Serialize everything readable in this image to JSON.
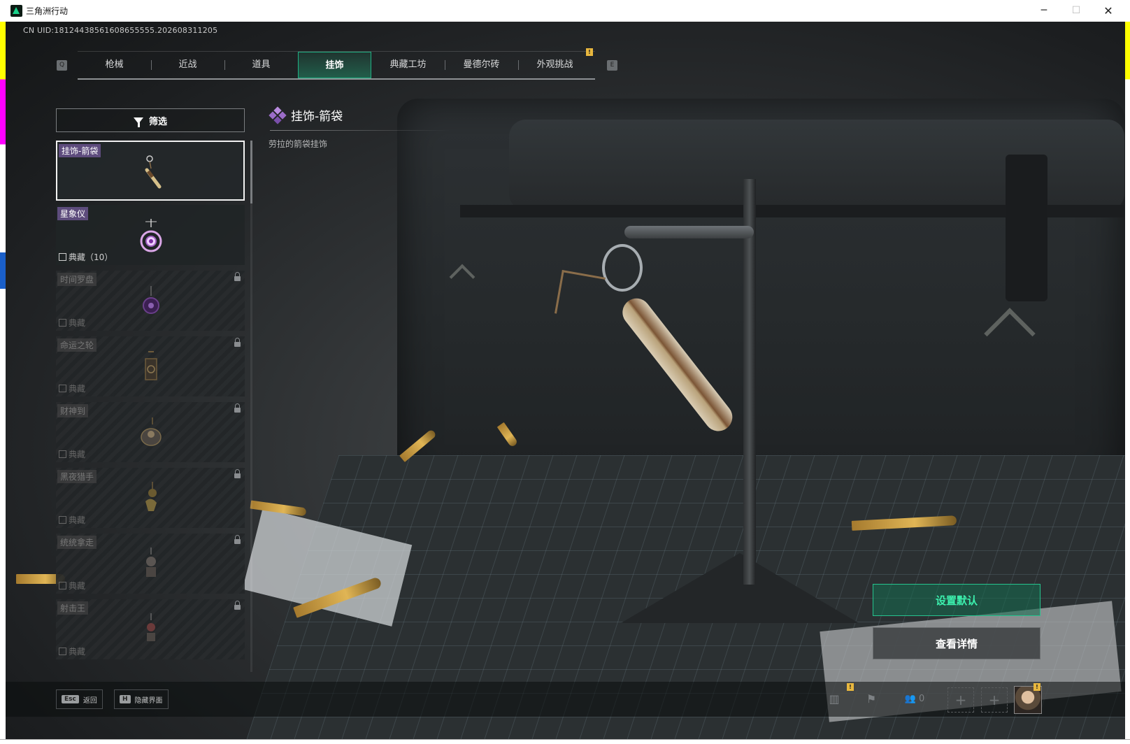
{
  "window": {
    "title": "三角洲行动",
    "controls": {
      "minimize": "─",
      "maximize": "☐",
      "close": "✕"
    }
  },
  "uid_text": "CN UID:18124438561608655555.202608311205",
  "tabs": {
    "prev_key": "Q",
    "next_key": "E",
    "items": [
      {
        "label": "枪械",
        "active": false
      },
      {
        "label": "近战",
        "active": false
      },
      {
        "label": "道具",
        "active": false
      },
      {
        "label": "挂饰",
        "active": true
      },
      {
        "label": "典藏工坊",
        "active": false
      },
      {
        "label": "曼德尔砖",
        "active": false
      },
      {
        "label": "外观挑战",
        "active": false
      }
    ],
    "badge": "!"
  },
  "filter": {
    "label": "筛选"
  },
  "items": [
    {
      "name": "挂饰-箭袋",
      "collection": "",
      "selected": true,
      "locked": false,
      "icon": "quiver-charm-icon"
    },
    {
      "name": "星象仪",
      "collection": "典藏（10）",
      "selected": false,
      "locked": false,
      "icon": "astrolabe-charm-icon"
    },
    {
      "name": "时间罗盘",
      "collection": "典藏",
      "selected": false,
      "locked": true,
      "icon": "time-compass-charm-icon"
    },
    {
      "name": "命运之轮",
      "collection": "典藏",
      "selected": false,
      "locked": true,
      "icon": "wheel-of-fate-charm-icon"
    },
    {
      "name": "财神到",
      "collection": "典藏",
      "selected": false,
      "locked": true,
      "icon": "god-of-wealth-charm-icon"
    },
    {
      "name": "黑夜猎手",
      "collection": "典藏",
      "selected": false,
      "locked": true,
      "icon": "night-hunter-charm-icon"
    },
    {
      "name": "统统拿走",
      "collection": "典藏",
      "selected": false,
      "locked": true,
      "icon": "take-all-charm-icon"
    },
    {
      "name": "射击王",
      "collection": "典藏",
      "selected": false,
      "locked": true,
      "icon": "shooting-king-charm-icon"
    }
  ],
  "detail": {
    "title": "挂饰-箭袋",
    "description": "劳拉的箭袋挂饰"
  },
  "actions": {
    "set_default": "设置默认",
    "view_details": "查看详情"
  },
  "bottom": {
    "back_key": "Esc",
    "back_label": "返回",
    "hide_key": "H",
    "hide_label": "隐藏界面",
    "friends_count": "0",
    "warn": "!"
  },
  "colors": {
    "accent": "#1fb184",
    "accent_text": "#3cf0ae",
    "rarity_purple": "#6a548c",
    "badge_yellow": "#e8b73e"
  }
}
